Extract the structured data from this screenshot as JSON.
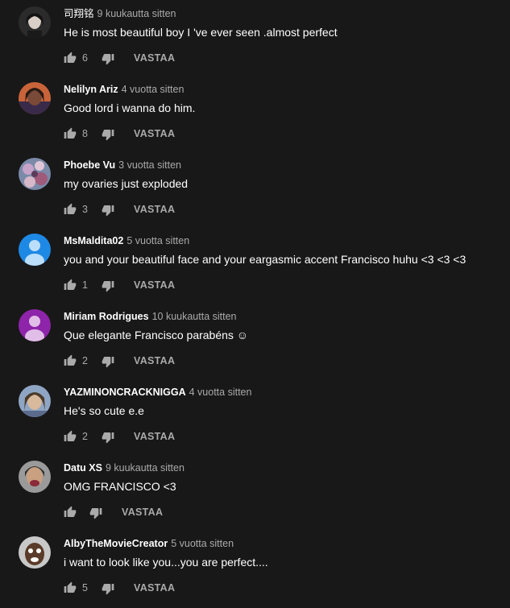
{
  "colors": {
    "background": "#181818",
    "text_primary": "#ffffff",
    "text_secondary": "#aaaaaa",
    "avatar_blue": "#1e88e5",
    "avatar_purple": "#8e24aa"
  },
  "icons": {
    "like": "thumb-up-icon",
    "dislike": "thumb-down-icon",
    "default_avatar": "person-icon"
  },
  "comments": [
    {
      "author": "司翔铭",
      "author_bold": false,
      "time": "9 kuukautta sitten",
      "text": "He is most beautiful boy I 've ever seen .almost perfect",
      "likes": "6",
      "reply_label": "VASTAA",
      "avatar": "photo"
    },
    {
      "author": "Nelilyn Ariz",
      "author_bold": true,
      "time": "4 vuotta sitten",
      "text": "Good lord i wanna do him.",
      "likes": "8",
      "reply_label": "VASTAA",
      "avatar": "photo"
    },
    {
      "author": "Phoebe Vu",
      "author_bold": true,
      "time": "3 vuotta sitten",
      "text": "my ovaries just exploded",
      "likes": "3",
      "reply_label": "VASTAA",
      "avatar": "photo"
    },
    {
      "author": "MsMaldita02",
      "author_bold": true,
      "time": "5 vuotta sitten",
      "text": "you and your beautiful face and your eargasmic accent Francisco huhu <3 <3 <3",
      "likes": "1",
      "reply_label": "VASTAA",
      "avatar": "default-blue"
    },
    {
      "author": "Miriam Rodrigues",
      "author_bold": true,
      "time": "10 kuukautta sitten",
      "text": "Que elegante Francisco parabéns ☺",
      "likes": "2",
      "reply_label": "VASTAA",
      "avatar": "default-purple"
    },
    {
      "author": "YAZMINONCRACKNIGGA",
      "author_bold": true,
      "time": "4 vuotta sitten",
      "text": "He's so cute e.e",
      "likes": "2",
      "reply_label": "VASTAA",
      "avatar": "photo"
    },
    {
      "author": "Datu XS",
      "author_bold": true,
      "time": "9 kuukautta sitten",
      "text": "OMG FRANCISCO <3",
      "likes": "",
      "reply_label": "VASTAA",
      "avatar": "photo"
    },
    {
      "author": "AlbyTheMovieCreator",
      "author_bold": true,
      "time": "5 vuotta sitten",
      "text": "i want to look like you...you are perfect....",
      "likes": "5",
      "reply_label": "VASTAA",
      "avatar": "photo"
    }
  ]
}
